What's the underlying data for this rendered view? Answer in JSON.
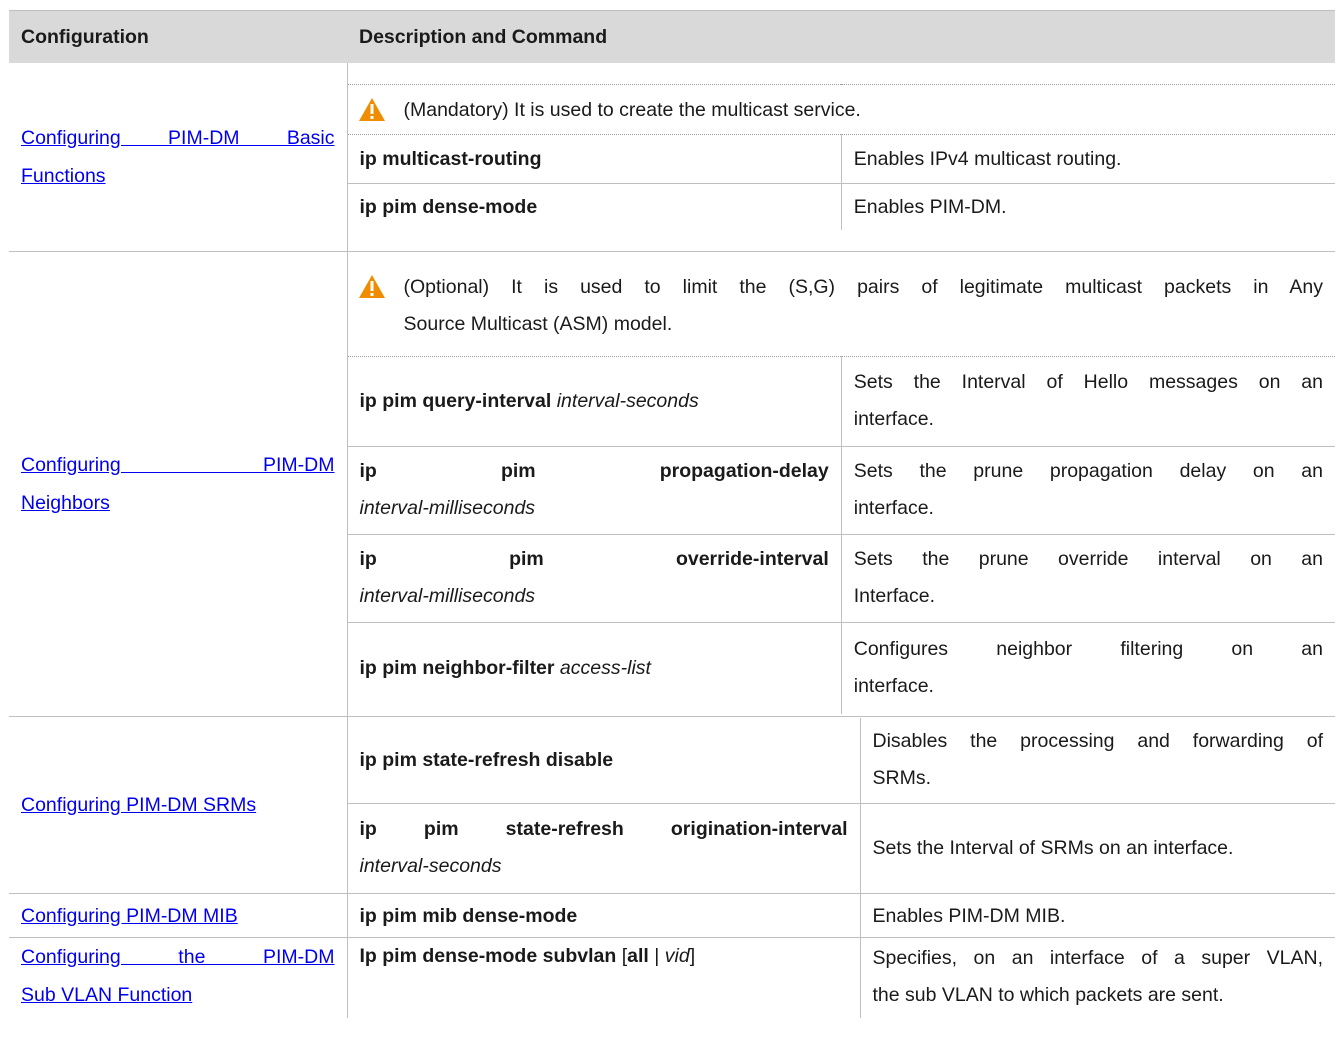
{
  "header": {
    "col1": "Configuration",
    "col2": "Description and Command"
  },
  "rows": [
    {
      "config_line1": "Configuring PIM-DM Basic",
      "config_line2": "Functions",
      "note": "(Mandatory) It is used to create the multicast service.",
      "commands": [
        {
          "cmd": "ip multicast-routing",
          "desc": "Enables IPv4 multicast routing."
        },
        {
          "cmd": "ip pim dense-mode",
          "desc": "Enables PIM-DM."
        }
      ]
    },
    {
      "config_line1": "Configuring PIM-DM",
      "config_line2": "Neighbors",
      "note_line1": "(Optional) It is used to limit the (S,G) pairs of legitimate multicast packets in Any",
      "note_line2": "Source Multicast (ASM) model.",
      "commands": [
        {
          "cmd": "ip pim query-interval",
          "arg": "interval-seconds",
          "desc_line1": "Sets the Interval of Hello messages on an",
          "desc_line2": "interface."
        },
        {
          "cmd_w1": "ip",
          "cmd_w2": "pim",
          "cmd_w3": "propagation-delay",
          "arg": "interval-milliseconds",
          "desc_line1": "Sets the prune propagation delay on an",
          "desc_line2": "interface."
        },
        {
          "cmd_w1": "ip",
          "cmd_w2": "pim",
          "cmd_w3": "override-interval",
          "arg": "interval-milliseconds",
          "desc_line1": "Sets the prune override interval on an",
          "desc_line2": "Interface."
        },
        {
          "cmd": "ip pim neighbor-filter",
          "arg": "access-list",
          "desc_line1": "Configures neighbor filtering on an",
          "desc_line2": "interface."
        }
      ]
    },
    {
      "config": "Configuring PIM-DM SRMs",
      "commands": [
        {
          "cmd": "ip pim state-refresh disable",
          "desc_line1": "Disables the processing and forwarding of",
          "desc_line2": "SRMs."
        },
        {
          "cmd": "ip pim state-refresh origination-interval",
          "arg": "interval-seconds",
          "desc": "Sets the Interval of SRMs on an interface."
        }
      ]
    },
    {
      "config": "Configuring PIM-DM MIB",
      "commands": [
        {
          "cmd": "ip pim mib dense-mode",
          "desc": "Enables PIM-DM MIB."
        }
      ]
    },
    {
      "config_line1": "Configuring the PIM-DM",
      "config_line2": "Sub VLAN Function",
      "commands": [
        {
          "cmd": "Ip pim dense-mode subvlan",
          "b1": "[",
          "all": "all",
          "sep": "|",
          "vid": "vid",
          "b2": "]",
          "desc_line1": "Specifies, on an interface of a super VLAN,",
          "desc_line2": "the sub VLAN to which packets are sent."
        }
      ]
    }
  ],
  "icons": {
    "warning": "warning-triangle-icon"
  },
  "colors": {
    "link": "#0000ee",
    "header_bg": "#d9d9d9",
    "warning": "#f08c00"
  }
}
